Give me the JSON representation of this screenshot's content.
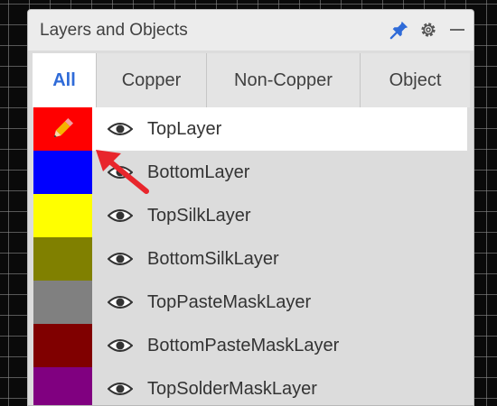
{
  "panel": {
    "title": "Layers and Objects",
    "icons": [
      "pin-icon",
      "gear-icon",
      "minimize-icon"
    ]
  },
  "tabs": [
    {
      "label": "All",
      "active": true
    },
    {
      "label": "Copper",
      "active": false
    },
    {
      "label": "Non-Copper",
      "active": false
    },
    {
      "label": "Object",
      "active": false
    }
  ],
  "layers": [
    {
      "name": "TopLayer",
      "color": "#ff0000",
      "selected": true
    },
    {
      "name": "BottomLayer",
      "color": "#0000ff",
      "selected": false
    },
    {
      "name": "TopSilkLayer",
      "color": "#ffff00",
      "selected": false
    },
    {
      "name": "BottomSilkLayer",
      "color": "#808000",
      "selected": false
    },
    {
      "name": "TopPasteMaskLayer",
      "color": "#808080",
      "selected": false
    },
    {
      "name": "BottomPasteMaskLayer",
      "color": "#800000",
      "selected": false
    },
    {
      "name": "TopSolderMaskLayer",
      "color": "#800080",
      "selected": false
    }
  ],
  "accent_color": "#2f6bd8",
  "annotation_arrow_color": "#e8262c"
}
